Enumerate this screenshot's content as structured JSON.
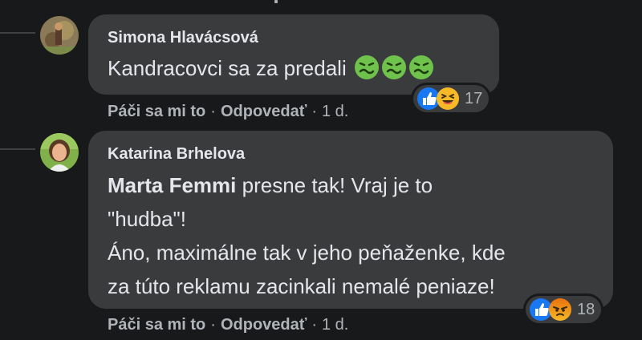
{
  "comments": [
    {
      "author": "Simona Hlavácsová",
      "text": "Kandracovci sa za predali",
      "emoji": [
        "nauseated-face",
        "nauseated-face",
        "nauseated-face"
      ],
      "reaction_icons": [
        "like-icon",
        "laugh-icon"
      ],
      "reaction_count": "17",
      "actions": {
        "like": "Páči sa mi to",
        "reply": "Odpovedať",
        "time": "1 d."
      }
    },
    {
      "author": "Katarina Brhelova",
      "mention": "Marta Femmi",
      "lines": [
        " presne tak! Vraj je to",
        "\"hudba\"!",
        "Áno, maximálne tak v jeho peňaženke, kde",
        "za túto reklamu zacinkali nemalé peniaze!"
      ],
      "reaction_icons": [
        "like-icon",
        "angry-icon"
      ],
      "reaction_count": "18",
      "actions": {
        "like": "Páči sa mi to",
        "reply": "Odpovedať",
        "time": "1 d."
      }
    }
  ],
  "separator": "·",
  "colors": {
    "background": "#18191a",
    "bubble": "#3a3b3c",
    "text": "#e4e6eb",
    "secondary": "#b0b3b8",
    "like_blue": "#1877f2",
    "emoji_yellow": "#f7b928",
    "nausea_green": "#6fc24b"
  }
}
